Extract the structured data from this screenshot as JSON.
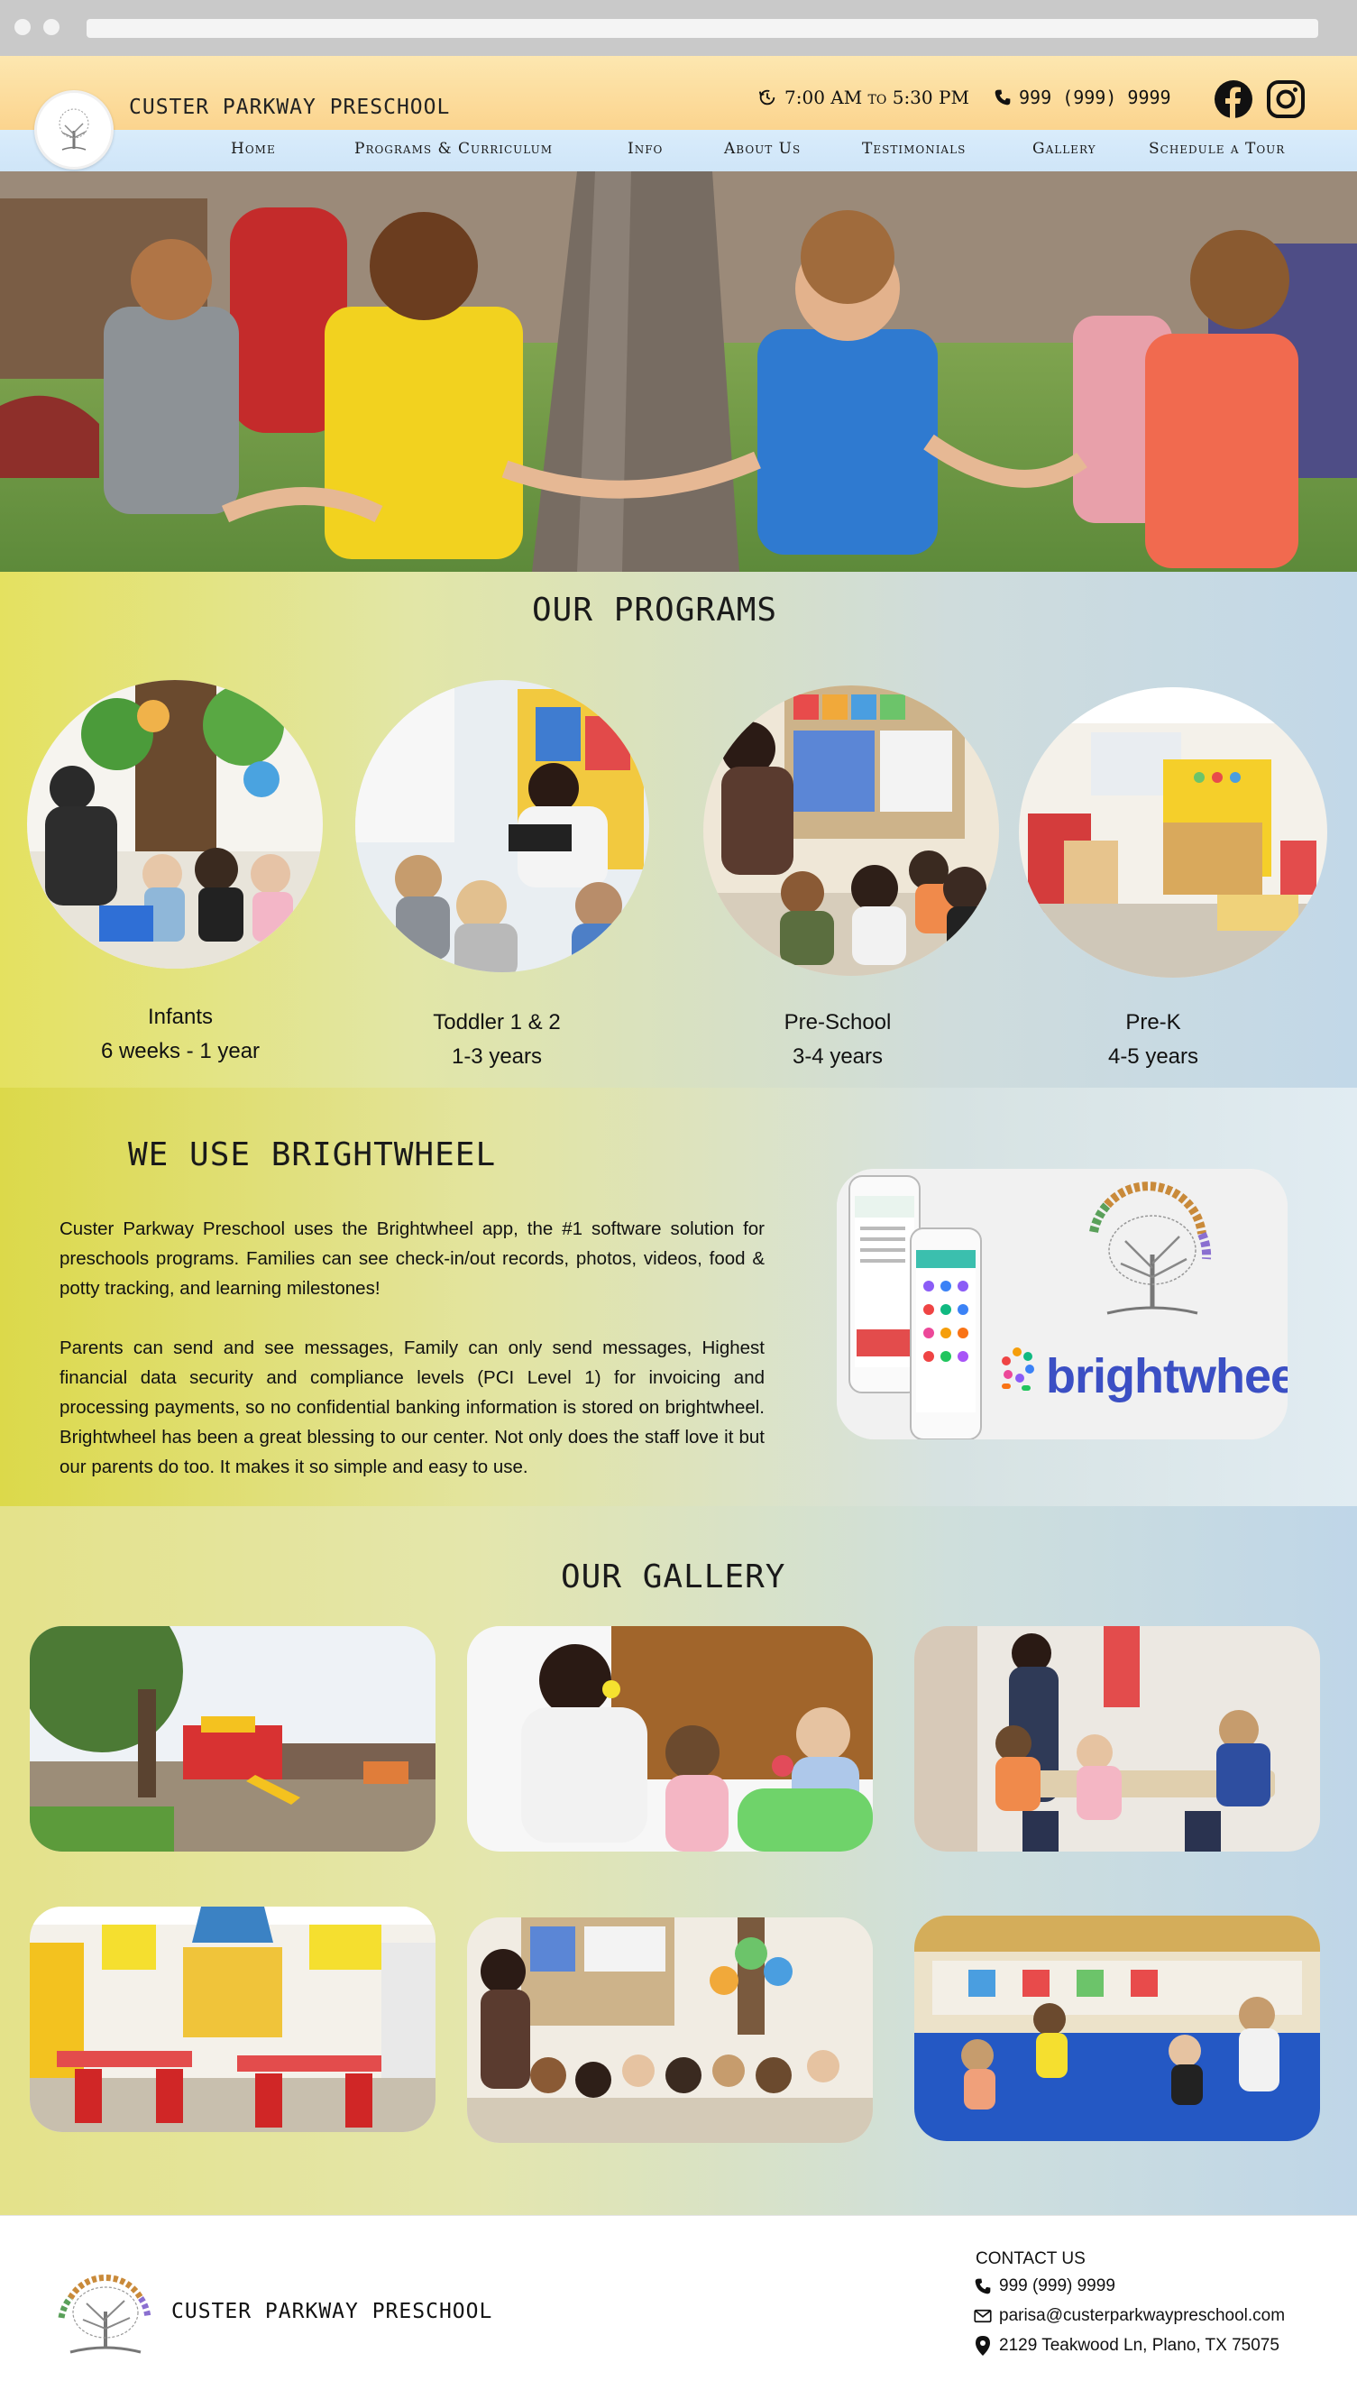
{
  "header": {
    "site_name": "Custer Parkway Preschool",
    "hours": "7:00 AM to 5:30 PM",
    "phone": "999 (999) 9999",
    "social": [
      "facebook-icon",
      "instagram-icon"
    ]
  },
  "nav": {
    "items": [
      {
        "label": "Home"
      },
      {
        "label": "Programs & Curriculum"
      },
      {
        "label": "Info"
      },
      {
        "label": "About Us"
      },
      {
        "label": "Testimonials"
      },
      {
        "label": "Gallery"
      },
      {
        "label": "Schedule a Tour"
      }
    ]
  },
  "programs": {
    "title": "OUR PROGRAMS",
    "items": [
      {
        "name": "Infants",
        "age": "6 weeks - 1 year"
      },
      {
        "name": "Toddler 1 & 2",
        "age": "1-3 years"
      },
      {
        "name": "Pre-School",
        "age": "3-4 years"
      },
      {
        "name": "Pre-K",
        "age": "4-5 years"
      }
    ]
  },
  "brightwheel": {
    "title": "WE USE BRIGHTWHEEL",
    "paragraph1": "Custer Parkway Preschool uses the Brightwheel app, the #1 software solution for preschools programs. Families can see check-in/out records, photos, videos, food & potty tracking, and learning milestones!",
    "paragraph2": "Parents can send and see messages, Family can only send messages, Highest financial data security and compliance levels (PCI Level 1) for invoicing and processing payments, so no confidential banking information is stored on brightwheel. Brightwheel has been a great blessing to our center. Not only does the staff love it but our parents do too. It makes it so simple and easy to use.",
    "logo_text": "brightwheel",
    "badge_text": "CUSTER PARKWAY PRESCHOOL"
  },
  "gallery": {
    "title": "OUR GALLERY"
  },
  "footer": {
    "site_name": "CUSTER PARKWAY PRESCHOOL",
    "contact_title": "CONTACT US",
    "phone": "999 (999) 9999",
    "email": "parisa@custerparkwaypreschool.com",
    "address": "2129 Teakwood Ln, Plano, TX 75075"
  },
  "colors": {
    "header_top": "#fbd48e",
    "nav_bar": "#d4e8f9",
    "brightwheel_blue": "#3b4fc4"
  }
}
